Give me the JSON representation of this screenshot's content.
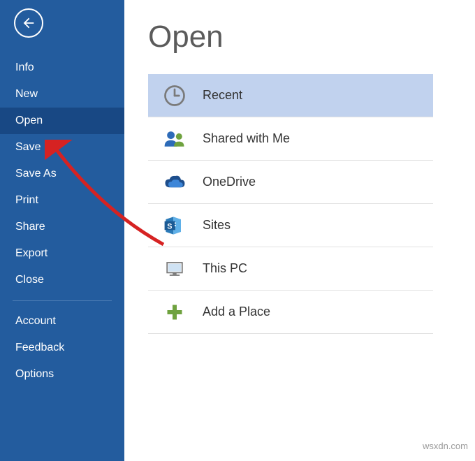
{
  "sidebar": {
    "items": [
      {
        "label": "Info",
        "selected": false
      },
      {
        "label": "New",
        "selected": false
      },
      {
        "label": "Open",
        "selected": true
      },
      {
        "label": "Save",
        "selected": false
      },
      {
        "label": "Save As",
        "selected": false
      },
      {
        "label": "Print",
        "selected": false
      },
      {
        "label": "Share",
        "selected": false
      },
      {
        "label": "Export",
        "selected": false
      },
      {
        "label": "Close",
        "selected": false
      }
    ],
    "footer_items": [
      {
        "label": "Account"
      },
      {
        "label": "Feedback"
      },
      {
        "label": "Options"
      }
    ]
  },
  "main": {
    "title": "Open",
    "locations": [
      {
        "icon": "clock-icon",
        "label": "Recent",
        "selected": true
      },
      {
        "icon": "people-icon",
        "label": "Shared with Me",
        "selected": false
      },
      {
        "icon": "cloud-icon",
        "label": "OneDrive",
        "selected": false
      },
      {
        "icon": "sites-icon",
        "label": "Sites",
        "selected": false
      },
      {
        "icon": "pc-icon",
        "label": "This PC",
        "selected": false
      },
      {
        "icon": "plus-icon",
        "label": "Add a Place",
        "selected": false
      }
    ]
  },
  "colors": {
    "sidebar_bg": "#235c9e",
    "sidebar_selected": "#184884",
    "location_selected": "#c1d2ee",
    "accent_blue": "#2d6bb8",
    "accent_green": "#6fa23f"
  },
  "watermark": "wsxdn.com"
}
